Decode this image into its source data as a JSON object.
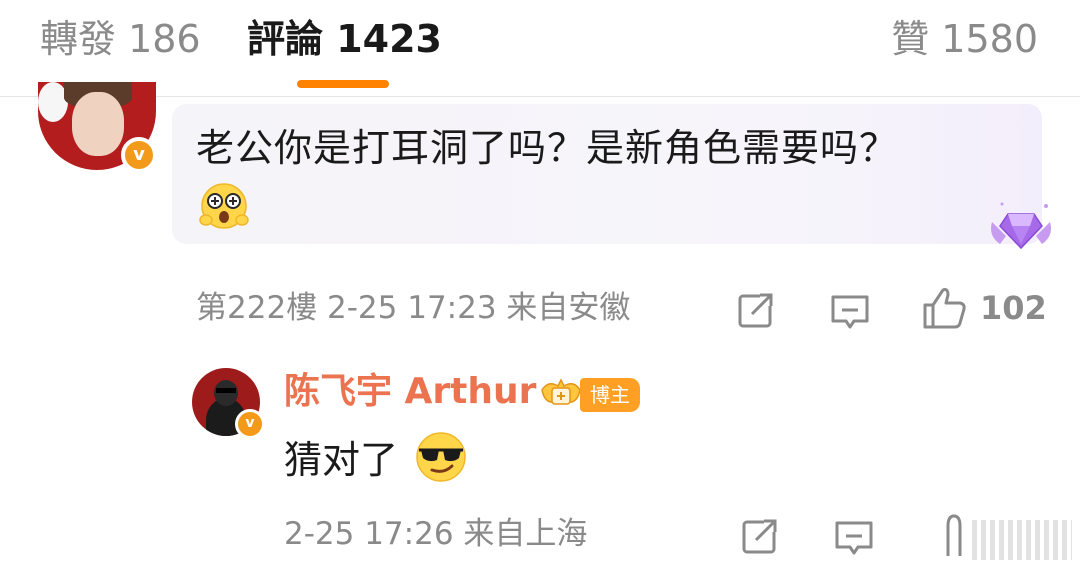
{
  "tabs": {
    "repost": "轉發 186",
    "comments": "評論 1423",
    "likes": "贊 1580",
    "accent": "#ff8200"
  },
  "comment": {
    "verified_badge": "v",
    "text": "老公你是打耳洞了吗？是新角色需要吗？",
    "meta": "第222樓 2-25 17:23 来自安徽",
    "like_count": "102",
    "icons": [
      "share-icon",
      "reply-icon",
      "thumbs-up-icon",
      "shock-emoji",
      "gem-fan-badge-icon"
    ]
  },
  "reply": {
    "author": "陈飞宇 Arthur",
    "author_color": "#eb7350",
    "tag": "博主",
    "tag_color": "#ffa024",
    "verified_badge": "v",
    "text": "猜对了",
    "meta": "2-25 17:26 来自上海",
    "icons": [
      "crown-icon",
      "cool-sunglasses-emoji",
      "share-icon",
      "reply-icon",
      "thumbs-up-icon"
    ]
  }
}
